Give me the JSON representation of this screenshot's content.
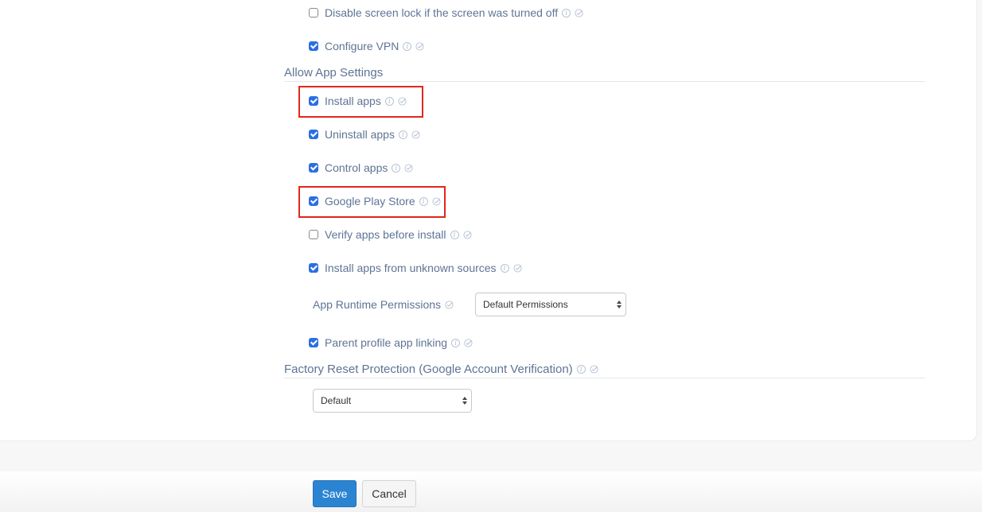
{
  "top_items": [
    {
      "label": "Disable screen lock if the screen was turned off",
      "checked": false,
      "info_icon": "info-icon",
      "verified_icon": "check-circle-icon"
    },
    {
      "label": "Configure VPN",
      "checked": true,
      "info_icon": "info-icon",
      "verified_icon": "check-circle-icon"
    }
  ],
  "allow_app_settings": {
    "title": "Allow App Settings",
    "items": [
      {
        "label": "Install apps",
        "checked": true,
        "highlighted": true
      },
      {
        "label": "Uninstall apps",
        "checked": true,
        "highlighted": false
      },
      {
        "label": "Control apps",
        "checked": true,
        "highlighted": false
      },
      {
        "label": "Google Play Store",
        "checked": true,
        "highlighted": true
      },
      {
        "label": "Verify apps before install",
        "checked": false,
        "highlighted": false
      },
      {
        "label": "Install apps from unknown sources",
        "checked": true,
        "highlighted": false
      }
    ],
    "runtime_permissions": {
      "label": "App Runtime Permissions",
      "selected": "Default Permissions"
    },
    "parent_linking": {
      "label": "Parent profile app linking",
      "checked": true
    }
  },
  "factory_reset": {
    "title": "Factory Reset Protection (Google Account Verification)",
    "selected": "Default"
  },
  "buttons": {
    "save": "Save",
    "cancel": "Cancel"
  },
  "colors": {
    "accent": "#2b84d2",
    "checkbox": "#2a6fe3",
    "highlight": "#e0271c",
    "text": "#5f7494"
  },
  "info_glyph": "i"
}
